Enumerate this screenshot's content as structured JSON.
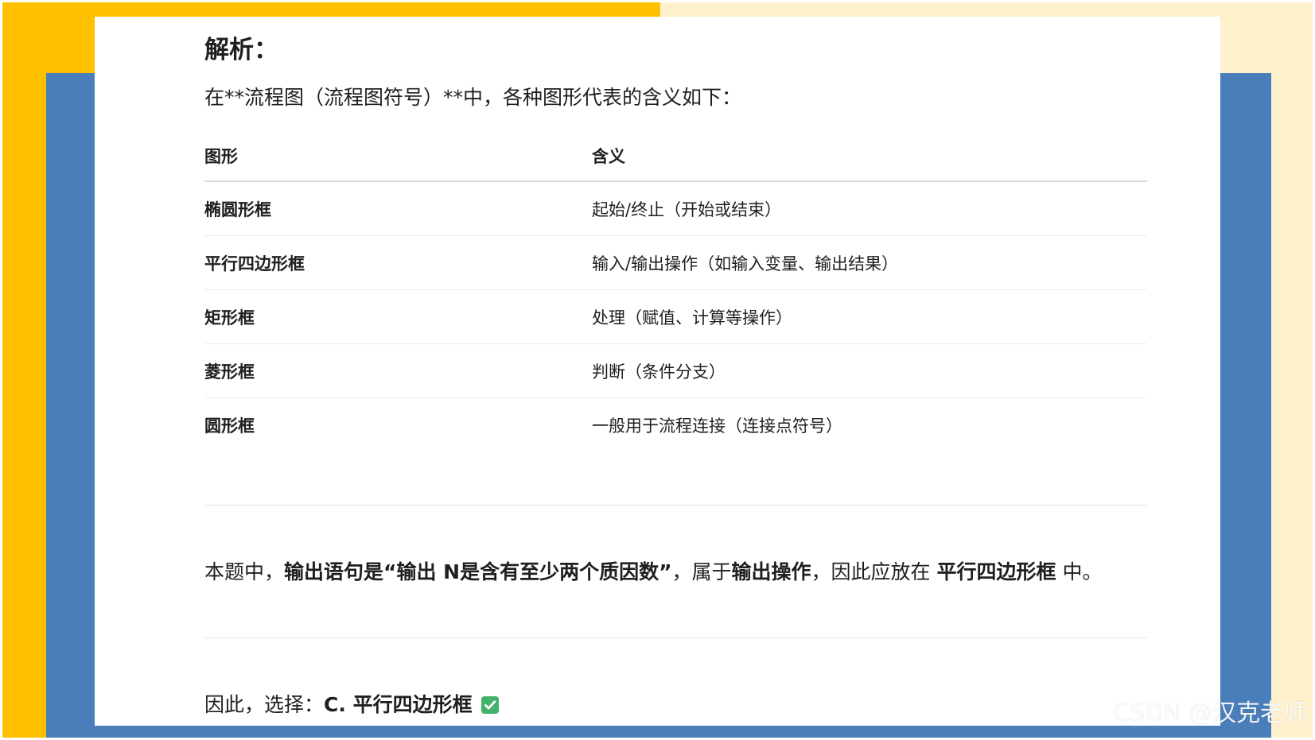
{
  "slide": {
    "colors": {
      "yellow": "#ffc000",
      "cream": "#fff1cc",
      "blue": "#4a7ebb",
      "paper": "#ffffff",
      "check": "#43b26a"
    }
  },
  "analysis": {
    "heading": "解析：",
    "intro": "在**流程图（流程图符号）**中，各种图形代表的含义如下：",
    "table": {
      "headers": [
        "图形",
        "含义"
      ],
      "rows": [
        [
          "椭圆形框",
          "起始/终止（开始或结束）"
        ],
        [
          "平行四边形框",
          "输入/输出操作（如输入变量、输出结果）"
        ],
        [
          "矩形框",
          "处理（赋值、计算等操作）"
        ],
        [
          "菱形框",
          "判断（条件分支）"
        ],
        [
          "圆形框",
          "一般用于流程连接（连接点符号）"
        ]
      ]
    },
    "conclusion": {
      "p1": "本题中，",
      "b1": "输出语句是“输出 N是含有至少两个质因数”",
      "p2": "，属于",
      "b2": "输出操作",
      "p3": "，因此应放在 ",
      "b3": "平行四边形框",
      "p4": " 中。"
    },
    "answer": {
      "prefix": "因此，选择：",
      "choice": "C. 平行四边形框",
      "icon": "check-mark-icon"
    }
  },
  "watermark": "CSDN @汉克老师"
}
